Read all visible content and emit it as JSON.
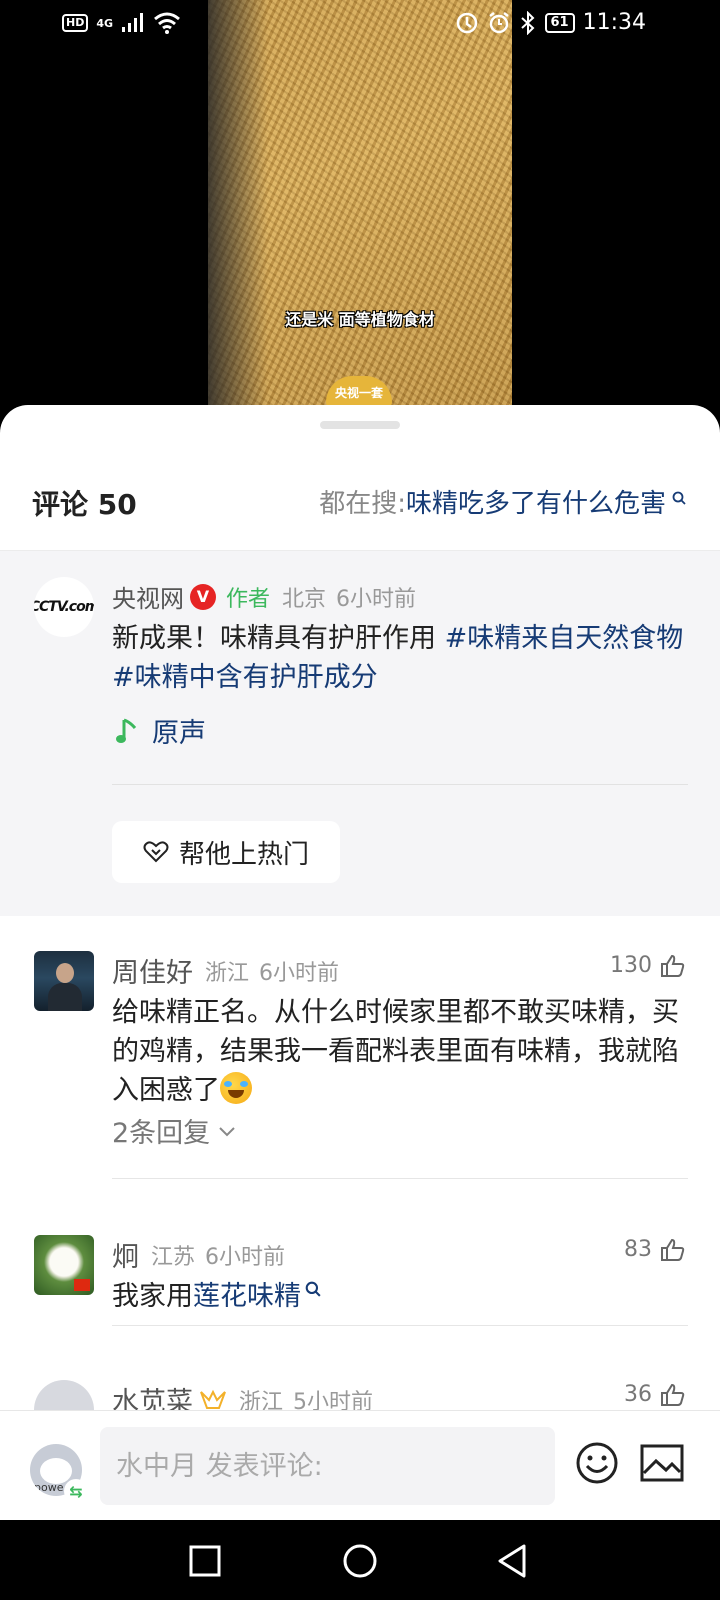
{
  "status_bar": {
    "left_badges": [
      "HD",
      "4G"
    ],
    "battery": "61",
    "time": "11:34"
  },
  "video": {
    "subtitle": "还是米 面等植物食材",
    "logo_text": "央视一套"
  },
  "header": {
    "comment_count": "评论 50",
    "search_prefix": "都在搜:",
    "search_query": "味精吃多了有什么危害"
  },
  "author_post": {
    "name": "央视网",
    "verified_badge": "V",
    "tag": "作者",
    "location": "北京",
    "time": "6小时前",
    "text": "新成果！味精具有护肝作用 ",
    "hashtag1": "#味精来自天然食物",
    "hashtag2": "#味精中含有护肝成分",
    "sound": "原声",
    "boost_button": "帮他上热门",
    "avatar_logo": "CCTV.com"
  },
  "comments": [
    {
      "name": "周佳好",
      "location": "浙江",
      "time": "6小时前",
      "likes": "130",
      "text": "给味精正名。从什么时候家里都不敢买味精，买的鸡精，结果我一看配料表里面有味精，我就陷入困惑了",
      "replies": "2条回复"
    },
    {
      "name": "炯",
      "location": "江苏",
      "time": "6小时前",
      "likes": "83",
      "text_prefix": "我家用",
      "text_link": "莲花味精"
    },
    {
      "name": "水苋菜",
      "location": "浙江",
      "time": "5小时前",
      "likes": "36"
    }
  ],
  "input_bar": {
    "placeholder": "水中月 发表评论:",
    "avatar_label": "powe"
  },
  "icons": {
    "search": "search-icon",
    "note": "music-note-icon",
    "heart": "heart-icon",
    "like": "thumbs-up-icon",
    "chevron": "chevron-down-icon",
    "emoji": "emoji-icon",
    "image": "image-icon"
  },
  "colors": {
    "link": "#163b75",
    "author_tag": "#3cb85d",
    "verified": "#e62424"
  }
}
